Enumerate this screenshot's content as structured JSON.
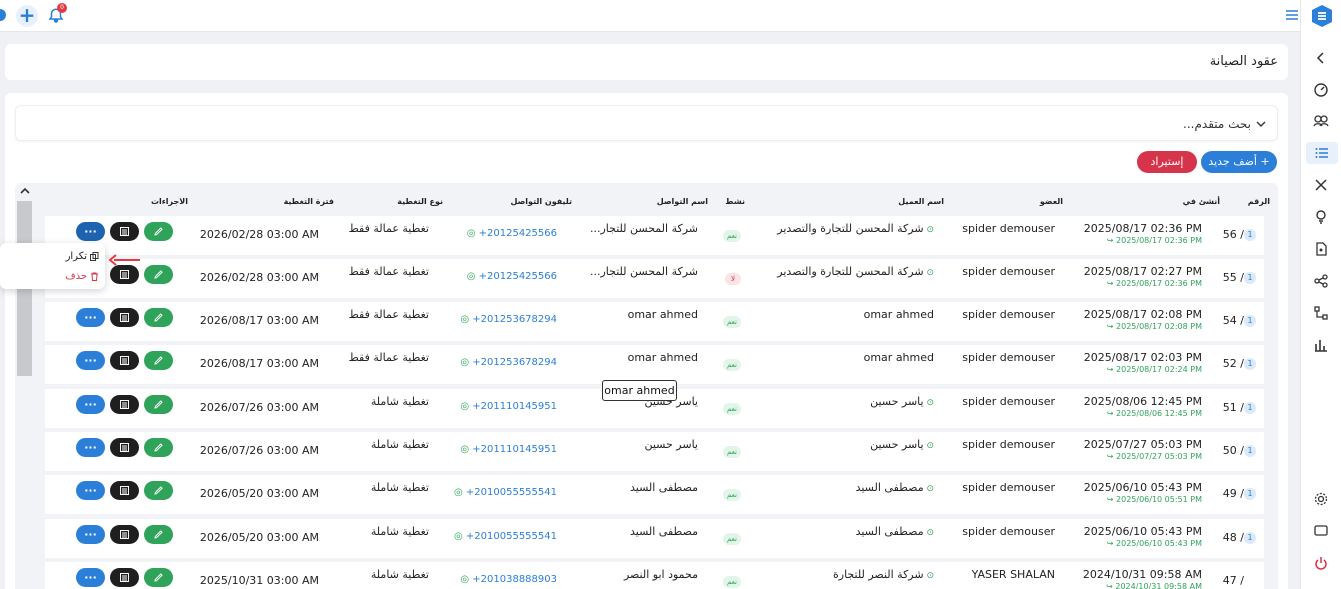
{
  "topbar": {
    "notif_count": "0"
  },
  "header": {
    "title": "عقود الصيانة"
  },
  "search": {
    "advanced_label": "بحث متقدم..."
  },
  "buttons": {
    "add_new": "+ أضف جديد",
    "import": "إستيراد"
  },
  "table": {
    "headers": {
      "number": "الرقم",
      "created_at": "أنشئ في",
      "member": "العضو",
      "client_name": "اسم العميل",
      "active": "نشط",
      "contact_name": "اسم التواصل",
      "contact_phone": "تليفون التواصل",
      "coverage_type": "نوع التغطية",
      "coverage_period": "فترة التغطية",
      "actions": "الاجراءات"
    },
    "rows": [
      {
        "num": "56 /",
        "badge": "1",
        "date": "2025/08/17 02:36 PM",
        "date2": "↪ 2025/08/17 02:36 PM",
        "member": "spider demouser",
        "client": "شركة المحسن للتجارة والتصدير",
        "client_icon": true,
        "active": "نعم",
        "active_yes": true,
        "contact": "شركة المحسن للتجار...",
        "phone": "+20125425566",
        "coverage": "تغطية عمالة فقط",
        "period": "2026/02/28 03:00 AM"
      },
      {
        "num": "55 /",
        "badge": "1",
        "date": "2025/08/17 02:27 PM",
        "date2": "↪ 2025/08/17 02:36 PM",
        "member": "spider demouser",
        "client": "شركة المحسن للتجارة والتصدير",
        "client_icon": true,
        "active": "لا",
        "active_yes": false,
        "contact": "شركة المحسن للتجار...",
        "phone": "+20125425566",
        "coverage": "تغطية عمالة فقط",
        "period": "2026/02/28 03:00 AM"
      },
      {
        "num": "54 /",
        "badge": "1",
        "date": "2025/08/17 02:08 PM",
        "date2": "↪ 2025/08/17 02:08 PM",
        "member": "spider demouser",
        "client": "omar ahmed",
        "client_icon": false,
        "active": "نعم",
        "active_yes": true,
        "contact": "omar ahmed",
        "phone": "+201253678294",
        "coverage": "تغطية عمالة فقط",
        "period": "2026/08/17 03:00 AM"
      },
      {
        "num": "52 /",
        "badge": "1",
        "date": "2025/08/17 02:03 PM",
        "date2": "↪ 2025/08/17 02:24 PM",
        "member": "spider demouser",
        "client": "omar ahmed",
        "client_icon": false,
        "active": "نعم",
        "active_yes": true,
        "contact": "omar ahmed",
        "phone": "+201253678294",
        "coverage": "تغطية عمالة فقط",
        "period": "2026/08/17 03:00 AM"
      },
      {
        "num": "51 /",
        "badge": "1",
        "date": "2025/08/06 12:45 PM",
        "date2": "↪ 2025/08/06 12:45 PM",
        "member": "spider demouser",
        "client": "ياسر حسين",
        "client_icon": true,
        "active": "نعم",
        "active_yes": true,
        "contact": "ياسر حسين",
        "phone": "+201110145951",
        "coverage": "تغطية شاملة",
        "period": "2026/07/26 03:00 AM"
      },
      {
        "num": "50 /",
        "badge": "1",
        "date": "2025/07/27 05:03 PM",
        "date2": "↪ 2025/07/27 05:03 PM",
        "member": "spider demouser",
        "client": "ياسر حسين",
        "client_icon": true,
        "active": "نعم",
        "active_yes": true,
        "contact": "ياسر حسين",
        "phone": "+201110145951",
        "coverage": "تغطية شاملة",
        "period": "2026/07/26 03:00 AM"
      },
      {
        "num": "49 /",
        "badge": "1",
        "date": "2025/06/10 05:43 PM",
        "date2": "↪ 2025/06/10 05:51 PM",
        "member": "spider demouser",
        "client": "مصطفى السيد",
        "client_icon": true,
        "active": "نعم",
        "active_yes": true,
        "contact": "مصطفى السيد",
        "phone": "+2010055555541",
        "coverage": "تغطية شاملة",
        "period": "2026/05/20 03:00 AM"
      },
      {
        "num": "48 /",
        "badge": "1",
        "date": "2025/06/10 05:43 PM",
        "date2": "↪ 2025/06/10 05:43 PM",
        "member": "spider demouser",
        "client": "مصطفى السيد",
        "client_icon": true,
        "active": "نعم",
        "active_yes": true,
        "contact": "مصطفى السيد",
        "phone": "+2010055555541",
        "coverage": "تغطية شاملة",
        "period": "2026/05/20 03:00 AM"
      },
      {
        "num": "47 /",
        "badge": "",
        "date": "2024/10/31 09:58 AM",
        "date2": "↪ 2024/10/31 09:58 AM",
        "member": "YASER SHALAN",
        "client": "شركة النصر للتجارة",
        "client_icon": true,
        "active": "نعم",
        "active_yes": true,
        "contact": "محمود ابو النصر",
        "phone": "+201038888903",
        "coverage": "تغطية شاملة",
        "period": "2025/10/31 03:00 AM"
      }
    ]
  },
  "popup": {
    "duplicate": "تكرار",
    "delete": "حذف"
  },
  "tooltip": {
    "text": "omar ahmed"
  },
  "colors": {
    "primary": "#2b7fd8",
    "danger": "#d6344a",
    "success": "#2fa35a",
    "dark": "#1f1f1f"
  }
}
